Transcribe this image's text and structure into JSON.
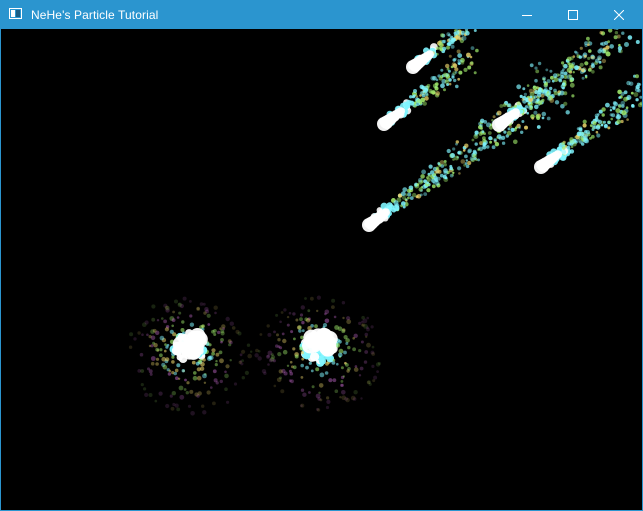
{
  "window": {
    "title": "NeHe's Particle Tutorial",
    "titlebar_color": "#2b95cf",
    "icons": {
      "app": "window-app-icon",
      "minimize": "minimize-icon",
      "maximize": "maximize-icon",
      "close": "close-icon"
    }
  },
  "scene": {
    "background": "#000000",
    "description_colors": [
      "#ffffff",
      "#7ff5ff",
      "#9ee86a",
      "#e8d26a",
      "#d070d8"
    ]
  }
}
